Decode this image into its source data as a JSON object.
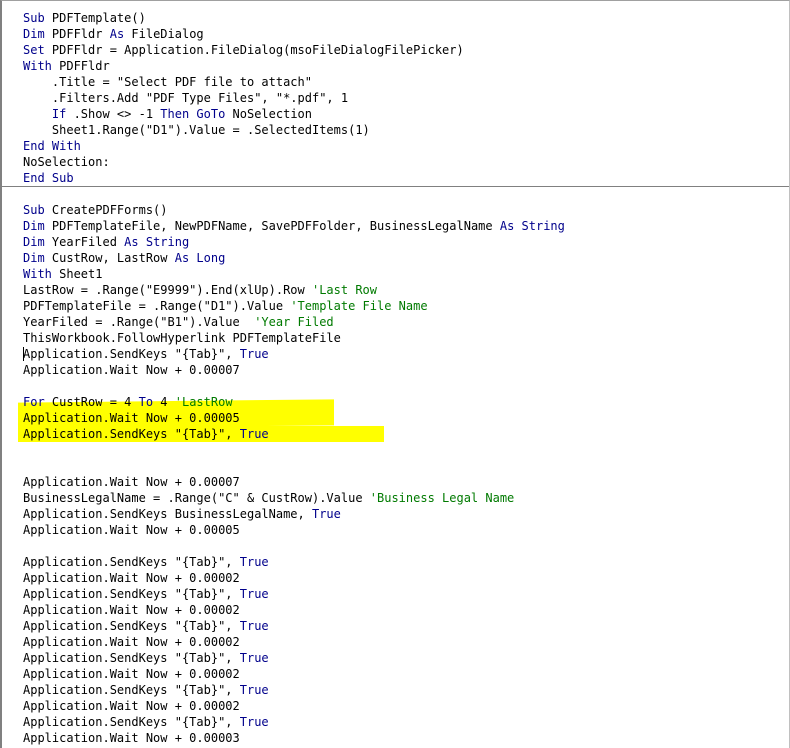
{
  "code_window": {
    "highlight_color": "#ffff00",
    "keyword_color": "#00008b",
    "comment_color": "#007a00",
    "lines": [
      [
        {
          "t": "Sub",
          "k": "kw"
        },
        {
          "t": " PDFTemplate()"
        }
      ],
      [
        {
          "t": "Dim",
          "k": "kw"
        },
        {
          "t": " PDFFldr "
        },
        {
          "t": "As",
          "k": "kw"
        },
        {
          "t": " FileDialog"
        }
      ],
      [
        {
          "t": "Set",
          "k": "kw"
        },
        {
          "t": " PDFFldr = Application.FileDialog(msoFileDialogFilePicker)"
        }
      ],
      [
        {
          "t": "With",
          "k": "kw"
        },
        {
          "t": " PDFFldr"
        }
      ],
      [
        {
          "t": "    .Title = \"Select PDF file to attach\""
        }
      ],
      [
        {
          "t": "    .Filters.Add \"PDF Type Files\", \"*.pdf\", 1"
        }
      ],
      [
        {
          "t": "    "
        },
        {
          "t": "If",
          "k": "kw"
        },
        {
          "t": " .Show <> -1 "
        },
        {
          "t": "Then GoTo",
          "k": "kw"
        },
        {
          "t": " NoSelection"
        }
      ],
      [
        {
          "t": "    Sheet1.Range(\"D1\").Value = .SelectedItems(1)"
        }
      ],
      [
        {
          "t": "End With",
          "k": "kw"
        }
      ],
      [
        {
          "t": "NoSelection:"
        }
      ],
      [
        {
          "t": "End Sub",
          "k": "kw"
        }
      ],
      [],
      [
        {
          "t": "Sub",
          "k": "kw"
        },
        {
          "t": " CreatePDFForms()"
        }
      ],
      [
        {
          "t": "Dim",
          "k": "kw"
        },
        {
          "t": " PDFTemplateFile, NewPDFName, SavePDFFolder, BusinessLegalName "
        },
        {
          "t": "As String",
          "k": "kw"
        }
      ],
      [
        {
          "t": "Dim",
          "k": "kw"
        },
        {
          "t": " YearFiled "
        },
        {
          "t": "As String",
          "k": "kw"
        }
      ],
      [
        {
          "t": "Dim",
          "k": "kw"
        },
        {
          "t": " CustRow, LastRow "
        },
        {
          "t": "As Long",
          "k": "kw"
        }
      ],
      [
        {
          "t": "With",
          "k": "kw"
        },
        {
          "t": " Sheet1"
        }
      ],
      [
        {
          "t": "LastRow = .Range(\"E9999\").End(xlUp).Row "
        },
        {
          "t": "'Last Row",
          "k": "cm"
        }
      ],
      [
        {
          "t": "PDFTemplateFile = .Range(\"D1\").Value "
        },
        {
          "t": "'Template File Name",
          "k": "cm"
        }
      ],
      [
        {
          "t": "YearFiled = .Range(\"B1\").Value  "
        },
        {
          "t": "'Year Filed",
          "k": "cm"
        }
      ],
      [
        {
          "t": "ThisWorkbook.FollowHyperlink PDFTemplateFile"
        }
      ],
      [
        {
          "t": "Application.SendKeys \"{Tab}\", "
        },
        {
          "t": "True",
          "k": "kw"
        }
      ],
      [
        {
          "t": "Application.Wait Now + 0.00007"
        }
      ],
      [],
      [
        {
          "t": "For",
          "k": "kw"
        },
        {
          "t": " CustRow = 4 "
        },
        {
          "t": "To",
          "k": "kw"
        },
        {
          "t": " 4 "
        },
        {
          "t": "'LastRow",
          "k": "cm"
        }
      ],
      [
        {
          "t": "Application.Wait Now + 0.00005"
        }
      ],
      [
        {
          "t": "Application.SendKeys \"{Tab}\", "
        },
        {
          "t": "True",
          "k": "kw"
        }
      ],
      [],
      [],
      [
        {
          "t": "Application.Wait Now + 0.00007"
        }
      ],
      [
        {
          "t": "BusinessLegalName = .Range(\"C\" & CustRow).Value "
        },
        {
          "t": "'Business Legal Name",
          "k": "cm"
        }
      ],
      [
        {
          "t": "Application.SendKeys BusinessLegalName, "
        },
        {
          "t": "True",
          "k": "kw"
        }
      ],
      [
        {
          "t": "Application.Wait Now + 0.00005"
        }
      ],
      [],
      [
        {
          "t": "Application.SendKeys \"{Tab}\", "
        },
        {
          "t": "True",
          "k": "kw"
        }
      ],
      [
        {
          "t": "Application.Wait Now + 0.00002"
        }
      ],
      [
        {
          "t": "Application.SendKeys \"{Tab}\", "
        },
        {
          "t": "True",
          "k": "kw"
        }
      ],
      [
        {
          "t": "Application.Wait Now + 0.00002"
        }
      ],
      [
        {
          "t": "Application.SendKeys \"{Tab}\", "
        },
        {
          "t": "True",
          "k": "kw"
        }
      ],
      [
        {
          "t": "Application.Wait Now + 0.00002"
        }
      ],
      [
        {
          "t": "Application.SendKeys \"{Tab}\", "
        },
        {
          "t": "True",
          "k": "kw"
        }
      ],
      [
        {
          "t": "Application.Wait Now + 0.00002"
        }
      ],
      [
        {
          "t": "Application.SendKeys \"{Tab}\", "
        },
        {
          "t": "True",
          "k": "kw"
        }
      ],
      [
        {
          "t": "Application.Wait Now + 0.00002"
        }
      ],
      [
        {
          "t": "Application.SendKeys \"{Tab}\", "
        },
        {
          "t": "True",
          "k": "kw"
        }
      ],
      [
        {
          "t": "Application.Wait Now + 0.00003"
        }
      ]
    ]
  }
}
